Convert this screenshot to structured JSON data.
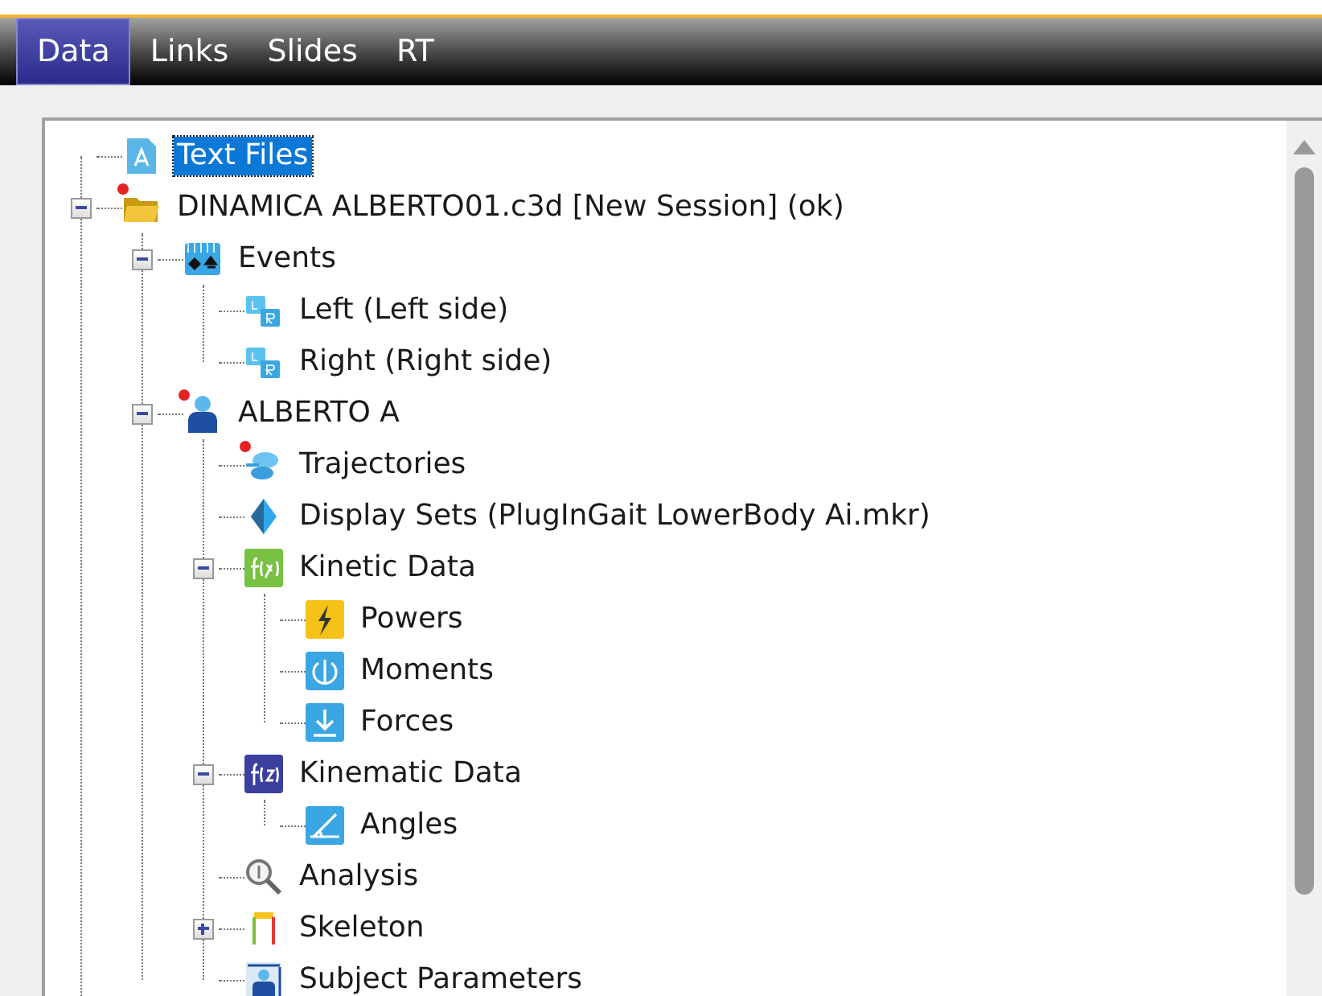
{
  "tabs": [
    {
      "label": "Data",
      "selected": true
    },
    {
      "label": "Links",
      "selected": false
    },
    {
      "label": "Slides",
      "selected": false
    },
    {
      "label": "RT",
      "selected": false
    }
  ],
  "tree": [
    {
      "label": "Text Files",
      "kind": "text-file",
      "selected": true,
      "flagged": false
    },
    {
      "label": "DINAMICA ALBERTO01.c3d [New Session] (ok)",
      "kind": "folder",
      "selected": false,
      "flagged": true,
      "expanded": true,
      "children": [
        {
          "label": "Events",
          "kind": "events",
          "selected": false,
          "flagged": false,
          "expanded": true,
          "children": [
            {
              "label": "Left (Left side)",
              "kind": "side",
              "selected": false,
              "flagged": false
            },
            {
              "label": "Right (Right side)",
              "kind": "side",
              "selected": false,
              "flagged": false
            }
          ]
        },
        {
          "label": "ALBERTO A",
          "kind": "subject",
          "selected": false,
          "flagged": true,
          "expanded": true,
          "children": [
            {
              "label": "Trajectories",
              "kind": "trajectories",
              "selected": false,
              "flagged": true
            },
            {
              "label": "Display Sets (PlugInGait LowerBody Ai.mkr)",
              "kind": "display-set",
              "selected": false,
              "flagged": false
            },
            {
              "label": "Kinetic Data",
              "kind": "kinetic",
              "selected": false,
              "flagged": false,
              "expanded": true,
              "children": [
                {
                  "label": "Powers",
                  "kind": "power",
                  "selected": false,
                  "flagged": false
                },
                {
                  "label": "Moments",
                  "kind": "moment",
                  "selected": false,
                  "flagged": false
                },
                {
                  "label": "Forces",
                  "kind": "force",
                  "selected": false,
                  "flagged": false
                }
              ]
            },
            {
              "label": "Kinematic Data",
              "kind": "kinematic",
              "selected": false,
              "flagged": false,
              "expanded": true,
              "children": [
                {
                  "label": "Angles",
                  "kind": "angle",
                  "selected": false,
                  "flagged": false
                }
              ]
            },
            {
              "label": "Analysis",
              "kind": "analysis",
              "selected": false,
              "flagged": false
            },
            {
              "label": "Skeleton",
              "kind": "skeleton",
              "selected": false,
              "flagged": false,
              "expanded": false
            },
            {
              "label": "Subject Parameters",
              "kind": "parameters",
              "selected": false,
              "flagged": false
            }
          ]
        }
      ]
    }
  ]
}
